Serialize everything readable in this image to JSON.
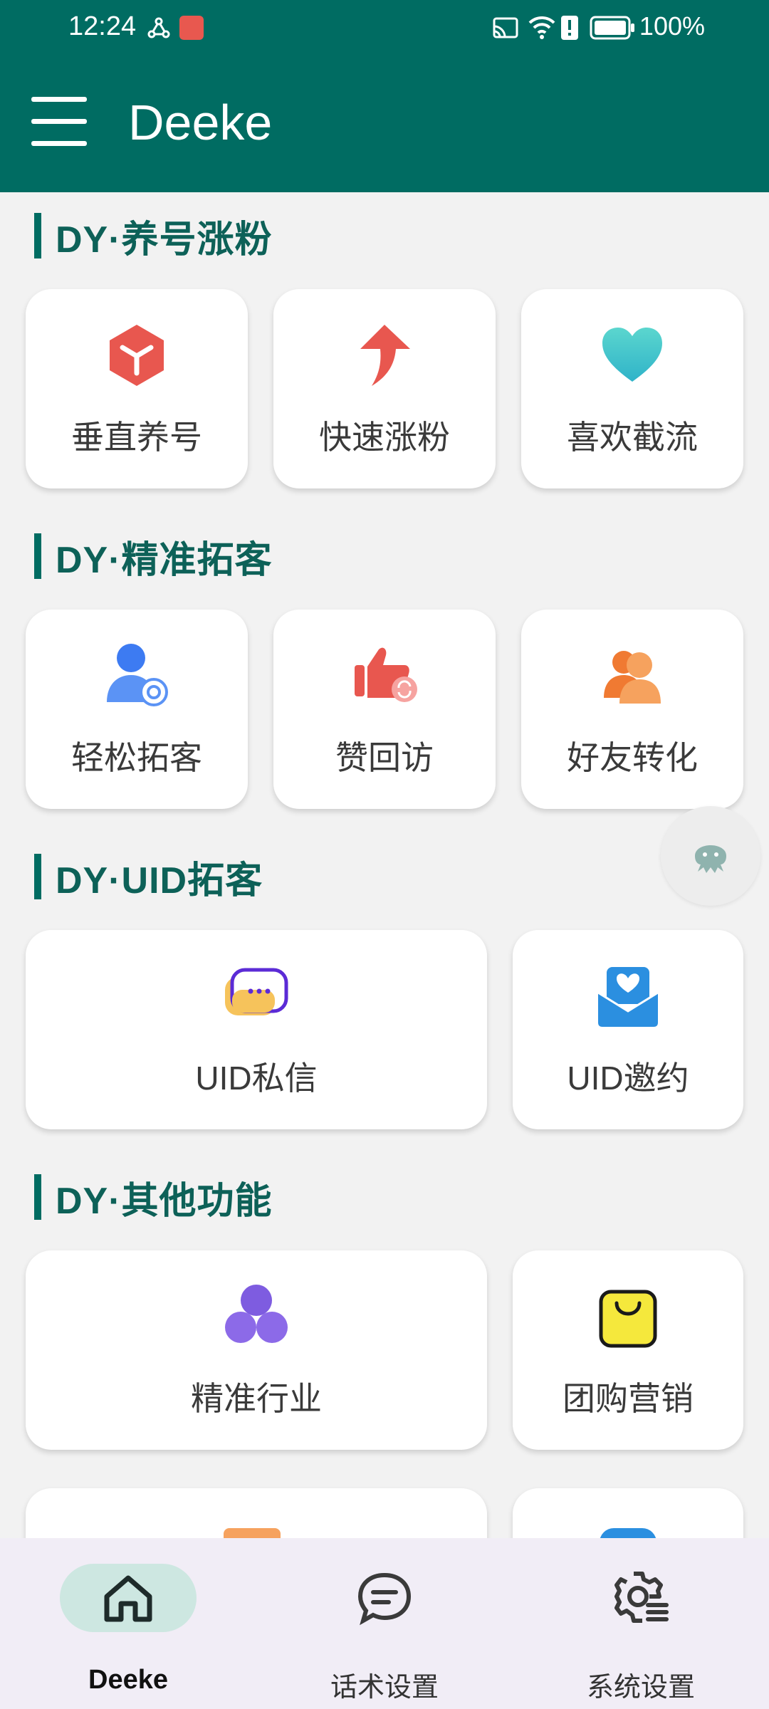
{
  "status": {
    "time": "12:24",
    "battery": "100%"
  },
  "app": {
    "title": "Deeke"
  },
  "sections": [
    {
      "title": "DY·养号涨粉",
      "items": [
        {
          "label": "垂直养号",
          "icon": "cube-icon"
        },
        {
          "label": "快速涨粉",
          "icon": "arrow-up-icon"
        },
        {
          "label": "喜欢截流",
          "icon": "heart-icon"
        }
      ]
    },
    {
      "title": "DY·精准拓客",
      "items": [
        {
          "label": "轻松拓客",
          "icon": "user-target-icon"
        },
        {
          "label": "赞回访",
          "icon": "thumbs-up-icon"
        },
        {
          "label": "好友转化",
          "icon": "friends-icon"
        }
      ]
    },
    {
      "title": "DY·UID拓客",
      "items": [
        {
          "label": "UID私信",
          "icon": "chat-bubble-icon"
        },
        {
          "label": "UID邀约",
          "icon": "mail-heart-icon"
        }
      ]
    },
    {
      "title": "DY·其他功能",
      "items": [
        {
          "label": "精准行业",
          "icon": "circles-icon"
        },
        {
          "label": "团购营销",
          "icon": "shopping-bag-icon"
        }
      ]
    }
  ],
  "nav": [
    {
      "label": "Deeke",
      "icon": "home-icon",
      "active": true
    },
    {
      "label": "话术设置",
      "icon": "message-icon"
    },
    {
      "label": "系统设置",
      "icon": "settings-icon"
    }
  ],
  "colors": {
    "primary": "#006C62",
    "background": "#F2F2F2",
    "nav_background": "#F1EDF6"
  }
}
